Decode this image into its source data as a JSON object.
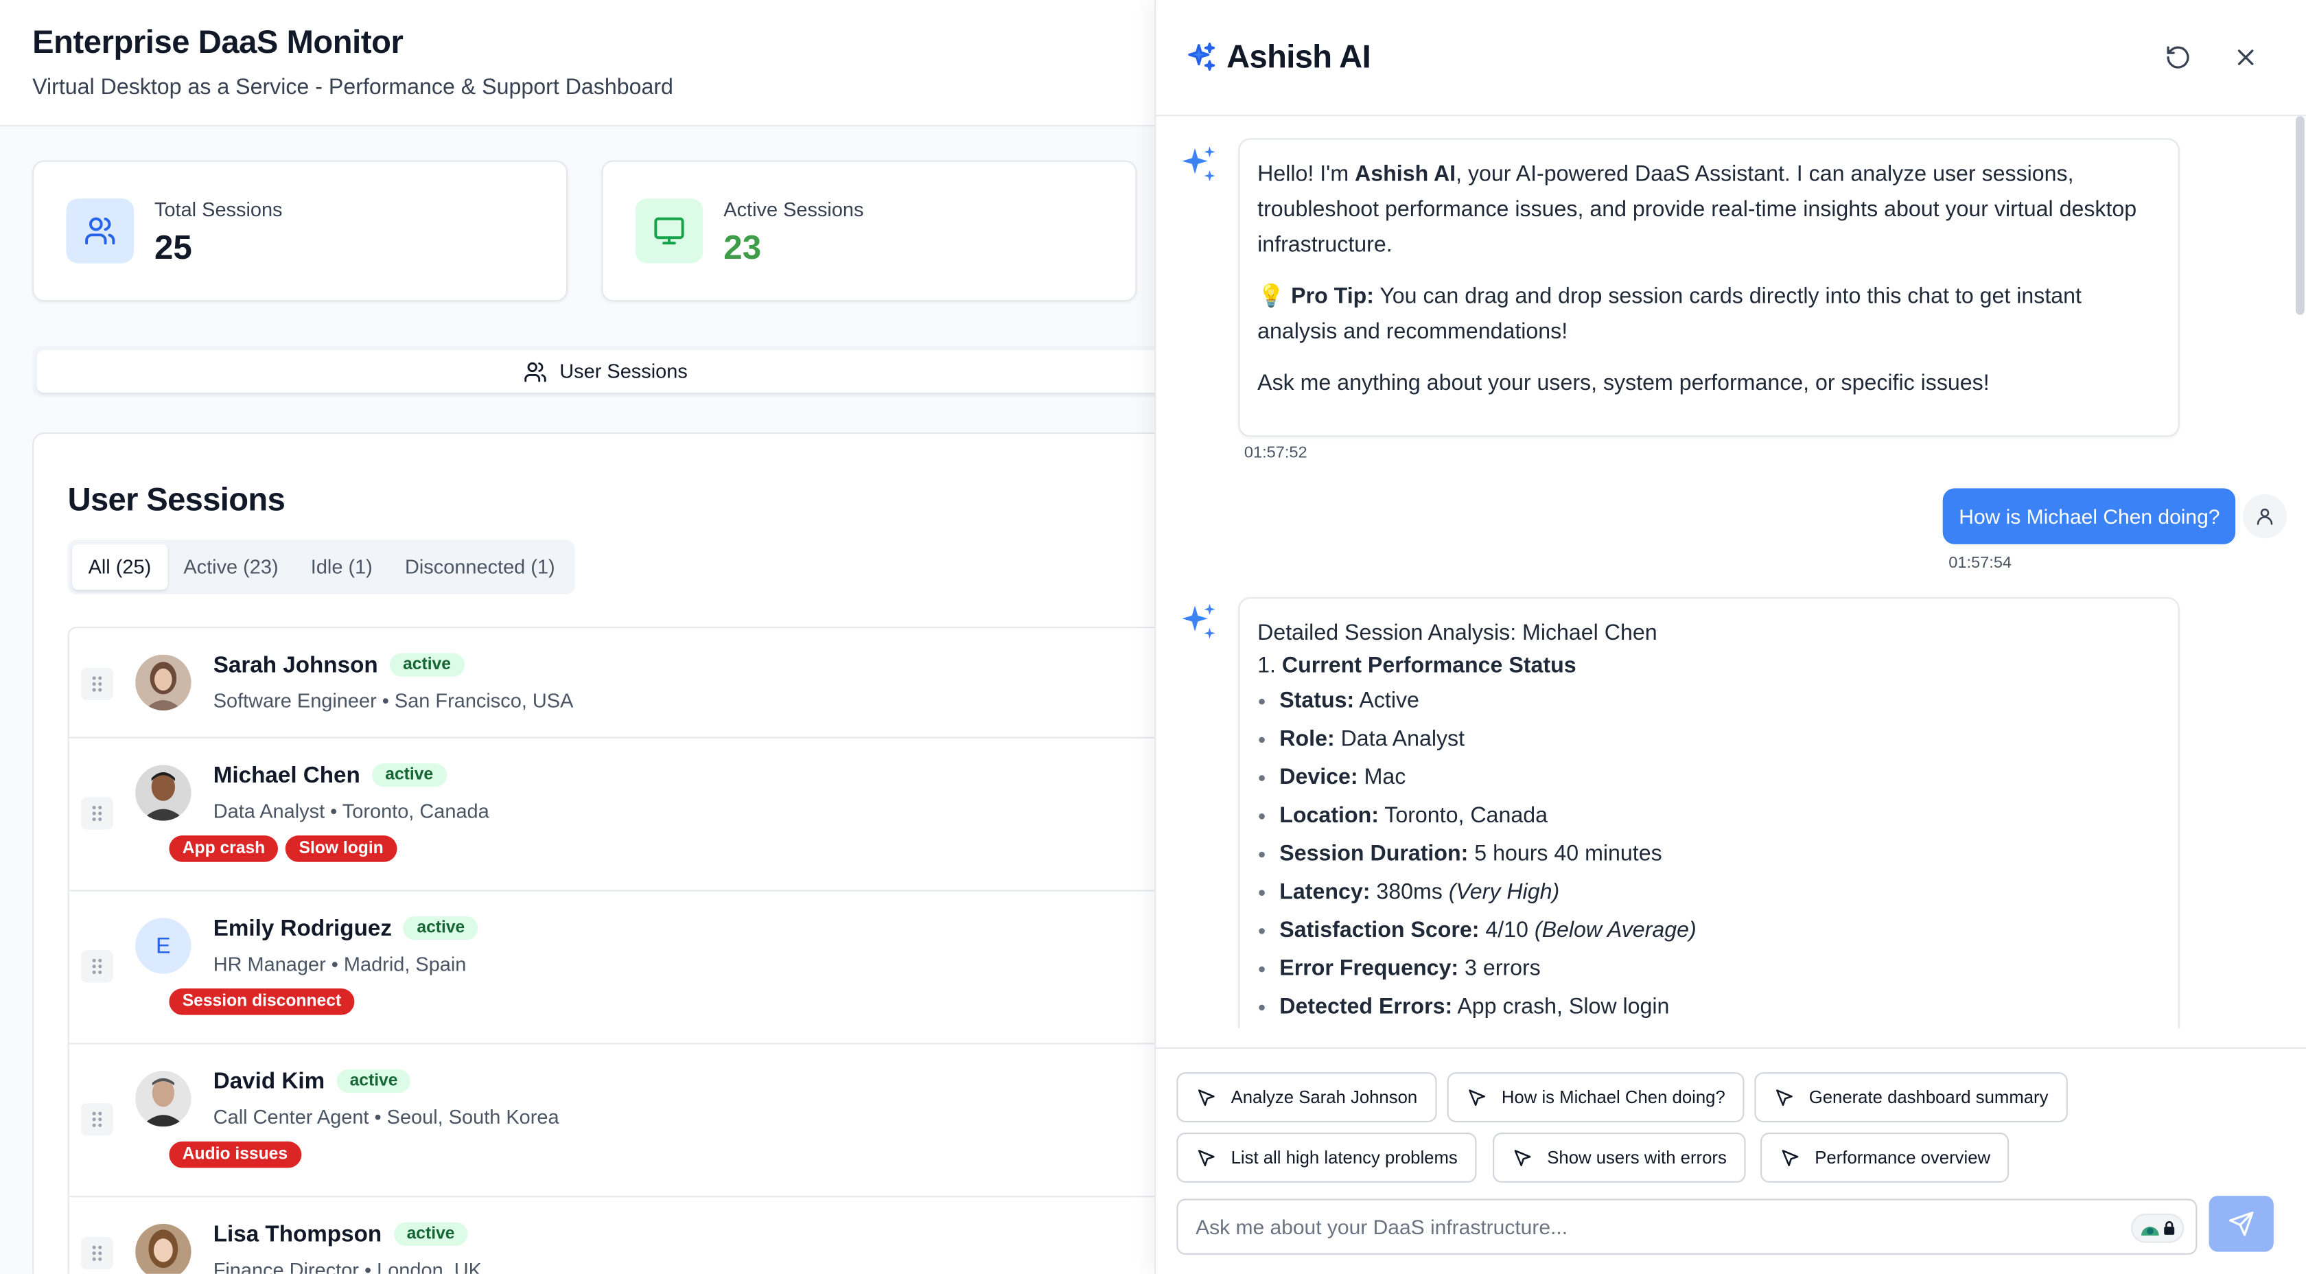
{
  "header": {
    "title": "Enterprise DaaS Monitor",
    "subtitle": "Virtual Desktop as a Service - Performance & Support Dashboard"
  },
  "stats": [
    {
      "label": "Total Sessions",
      "value": "25",
      "icon": "users-icon",
      "color": "#111827"
    },
    {
      "label": "Active Sessions",
      "value": "23",
      "icon": "monitor-icon",
      "color": "#16a34a"
    }
  ],
  "tab": {
    "label": "User Sessions",
    "icon": "users-icon"
  },
  "sessions_panel": {
    "title": "User Sessions",
    "filters": [
      "All (25)",
      "Active (23)",
      "Idle (1)",
      "Disconnected (1)"
    ],
    "selected_filter": "All (25)"
  },
  "sessions": [
    {
      "name": "Sarah Johnson",
      "status": "active",
      "meta": "Software Engineer • San Francisco, USA",
      "issues": []
    },
    {
      "name": "Michael Chen",
      "status": "active",
      "meta": "Data Analyst • Toronto, Canada",
      "issues": [
        "App crash",
        "Slow login"
      ]
    },
    {
      "name": "Emily Rodriguez",
      "status": "active",
      "meta": "HR Manager • Madrid, Spain",
      "initial": "E",
      "issues": [
        "Session disconnect"
      ]
    },
    {
      "name": "David Kim",
      "status": "active",
      "meta": "Call Center Agent • Seoul, South Korea",
      "issues": [
        "Audio issues"
      ]
    },
    {
      "name": "Lisa Thompson",
      "status": "active",
      "meta": "Finance Director • London, UK",
      "issues": []
    }
  ],
  "chat": {
    "title": "Ashish AI",
    "welcome": {
      "hello_prefix": "Hello! I'm ",
      "hello_name": "Ashish AI",
      "hello_rest": ", your AI-powered DaaS Assistant. I can analyze user sessions, troubleshoot performance issues, and provide real-time insights about your virtual desktop infrastructure.",
      "tip_icon": "💡",
      "tip_label": "Pro Tip:",
      "tip_text": " You can drag and drop session cards directly into this chat to get instant analysis and recommendations!",
      "ask": "Ask me anything about your users, system performance, or specific issues!",
      "time": "01:57:52"
    },
    "user_message": {
      "text": "How is Michael Chen doing?",
      "time": "01:57:54"
    },
    "analysis": {
      "heading": "Detailed Session Analysis: Michael Chen",
      "section_number": "1.",
      "section_title": "Current Performance Status",
      "items": [
        {
          "label": "Status:",
          "value": " Active",
          "note": ""
        },
        {
          "label": "Role:",
          "value": " Data Analyst",
          "note": ""
        },
        {
          "label": "Device:",
          "value": " Mac",
          "note": ""
        },
        {
          "label": "Location:",
          "value": " Toronto, Canada",
          "note": ""
        },
        {
          "label": "Session Duration:",
          "value": " 5 hours 40 minutes",
          "note": ""
        },
        {
          "label": "Latency:",
          "value": " 380ms ",
          "note": "(Very High)"
        },
        {
          "label": "Satisfaction Score:",
          "value": " 4/10 ",
          "note": "(Below Average)"
        },
        {
          "label": "Error Frequency:",
          "value": " 3 errors",
          "note": ""
        },
        {
          "label": "Detected Errors:",
          "value": " App crash, Slow login",
          "note": ""
        }
      ]
    },
    "quick_actions": [
      "Analyze Sarah Johnson",
      "How is Michael Chen doing?",
      "Generate dashboard summary",
      "List all high latency problems",
      "Show users with errors",
      "Performance overview"
    ],
    "input": {
      "placeholder": "Ask me about your DaaS infrastructure...",
      "value": ""
    }
  },
  "colors": {
    "accent": "#3b82f6",
    "danger": "#dc2626",
    "success": "#16a34a",
    "active_badge_bg": "#dcfce7"
  }
}
